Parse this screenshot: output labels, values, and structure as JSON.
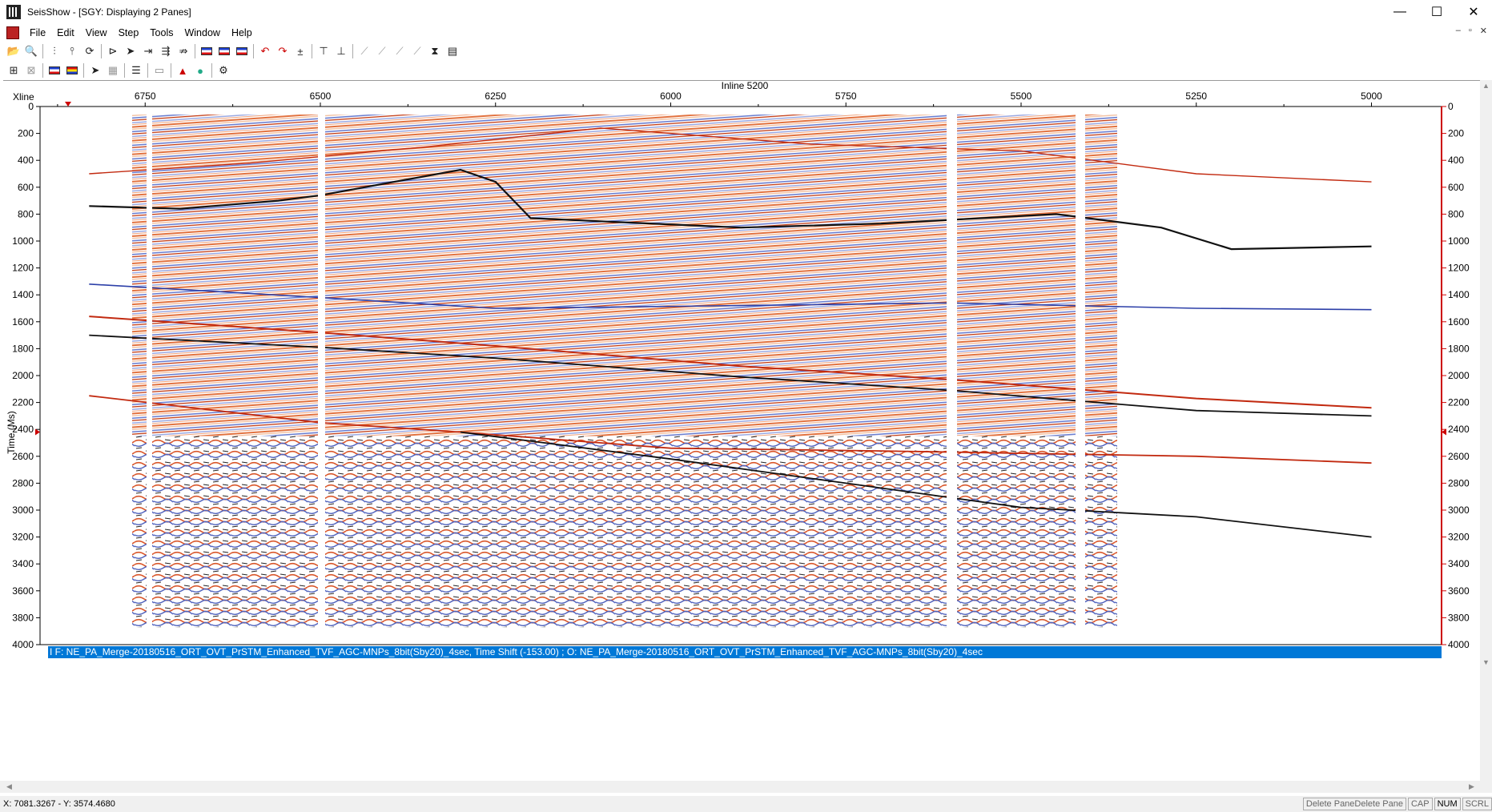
{
  "window": {
    "title": "SeisShow - [SGY: Displaying 2 Panes]",
    "controls": {
      "minimize": "—",
      "maximize": "☐",
      "close": "✕"
    }
  },
  "menu": [
    "File",
    "Edit",
    "View",
    "Step",
    "Tools",
    "Window",
    "Help"
  ],
  "mdi_controls": [
    "–",
    "▫",
    "✕"
  ],
  "toolbar1": [
    "open-icon",
    "zoom-icon",
    "seismic-icon",
    "pick-icon",
    "refresh-icon",
    "step-left-icon",
    "step-right-icon",
    "step-left-fast-icon",
    "step-right-fast-icon",
    "step-skip-icon",
    "color-scheme-1-icon",
    "color-scheme-2-icon",
    "color-scheme-3-icon",
    "undo-icon",
    "redo-icon",
    "math-icon",
    "header-icon",
    "header2-icon",
    "tool1-icon",
    "tool2-icon",
    "tool3-icon",
    "tool4-icon",
    "tool5-icon",
    "tool6-icon"
  ],
  "toolbar2": [
    "add-pane-icon",
    "close-pane-icon",
    "colorbar-icon",
    "palette-icon",
    "step-icon",
    "grid-icon",
    "horizon-icon",
    "flatten-icon",
    "amplitude-icon",
    "color-wheel-icon",
    "settings-icon"
  ],
  "chart_data": {
    "type": "heatmap",
    "title": "Inline 5200",
    "x_axis_label": "Xline",
    "y_axis_label": "Time (Ms)",
    "x_ticks": [
      6750,
      6500,
      6250,
      6000,
      5750,
      5500,
      5250,
      5000
    ],
    "y_ticks": [
      0,
      200,
      400,
      600,
      800,
      1000,
      1200,
      1400,
      1600,
      1800,
      2000,
      2200,
      2400,
      2600,
      2800,
      3000,
      3200,
      3400,
      3600,
      3800,
      4000
    ],
    "right_y_ticks": [
      0,
      200,
      400,
      600,
      800,
      1000,
      1200,
      1400,
      1600,
      1800,
      2000,
      2200,
      2400,
      2600,
      2800,
      3000,
      3200,
      3400,
      3600,
      3800,
      4000
    ],
    "x_range": [
      6900,
      4900
    ],
    "y_range": [
      0,
      4000
    ],
    "colors": {
      "positive": "#d7461b",
      "strong": "#111111",
      "negative": "#2c3fa8",
      "axis_right": "#cc0000",
      "banner": "#0078d7"
    }
  },
  "banner_text": "I F: NE_PA_Merge-20180516_ORT_OVT_PrSTM_Enhanced_TVF_AGC-MNPs_8bit(Sby20)_4sec, Time Shift (-153.00) ; O: NE_PA_Merge-20180516_ORT_OVT_PrSTM_Enhanced_TVF_AGC-MNPs_8bit(Sby20)_4sec",
  "status": {
    "coords": "X: 7081.3267 - Y: 3574.4680",
    "pane_info": "Delete PaneDelete Pane",
    "cap": "CAP",
    "num": "NUM",
    "scrl": "SCRL"
  }
}
